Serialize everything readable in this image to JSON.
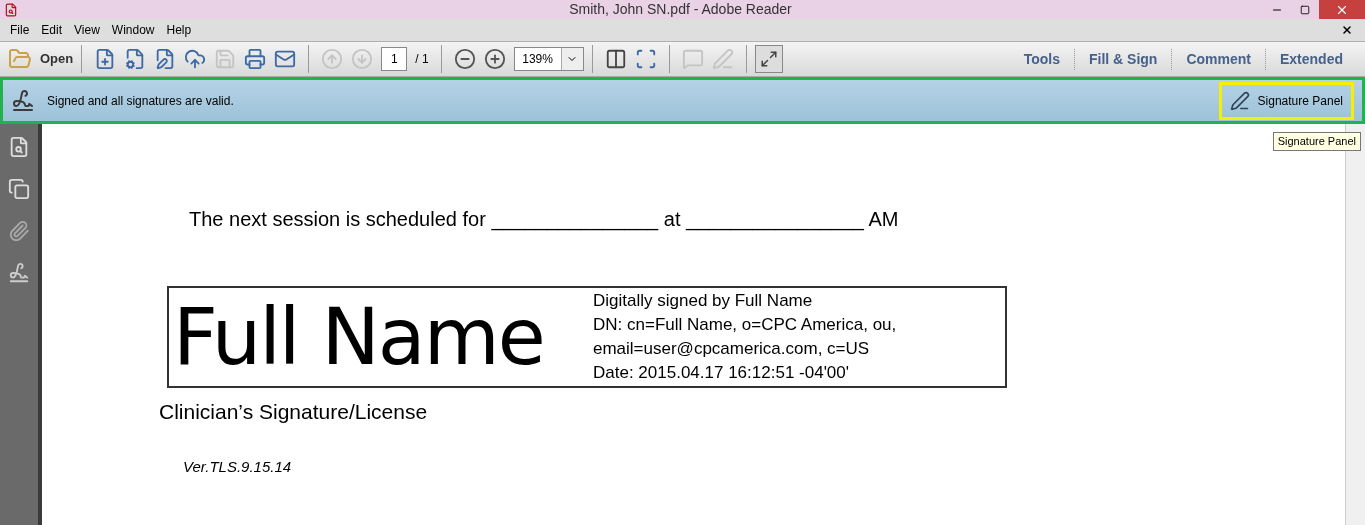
{
  "window": {
    "title": "Smith, John SN.pdf - Adobe Reader"
  },
  "menu": [
    "File",
    "Edit",
    "View",
    "Window",
    "Help"
  ],
  "toolbar": {
    "open_label": "Open",
    "icons_1": [
      {
        "kind": "create",
        "disabled": false
      },
      {
        "kind": "convert",
        "disabled": false
      },
      {
        "kind": "edit",
        "disabled": false
      },
      {
        "kind": "upload",
        "disabled": false
      },
      {
        "kind": "save",
        "disabled": true
      },
      {
        "kind": "print",
        "disabled": false
      },
      {
        "kind": "mail",
        "disabled": false
      }
    ],
    "nav": [
      {
        "kind": "up",
        "disabled": true
      },
      {
        "kind": "down",
        "disabled": true
      }
    ],
    "page": "1",
    "page_total": "/ 1",
    "zoom": "139%",
    "icons_2": [
      {
        "kind": "comment",
        "disabled": true
      },
      {
        "kind": "markup",
        "disabled": true
      }
    ],
    "panels": [
      "Tools",
      "Fill & Sign",
      "Comment",
      "Extended"
    ]
  },
  "message_bar": {
    "text": "Signed and all signatures are valid.",
    "button": "Signature Panel",
    "tooltip": "Signature Panel"
  },
  "document": {
    "sentence": "The next session is scheduled for _______________ at ________________ AM",
    "signature": {
      "name": "Full Name",
      "details": [
        "Digitally signed by Full Name",
        "DN: cn=Full Name, o=CPC America, ou,",
        "email=user@cpcamerica.com, c=US",
        "Date: 2015.04.17 16:12:51 -04'00'"
      ]
    },
    "caption": "Clinician’s Signature/License",
    "version": "Ver.TLS.9.15.14"
  }
}
